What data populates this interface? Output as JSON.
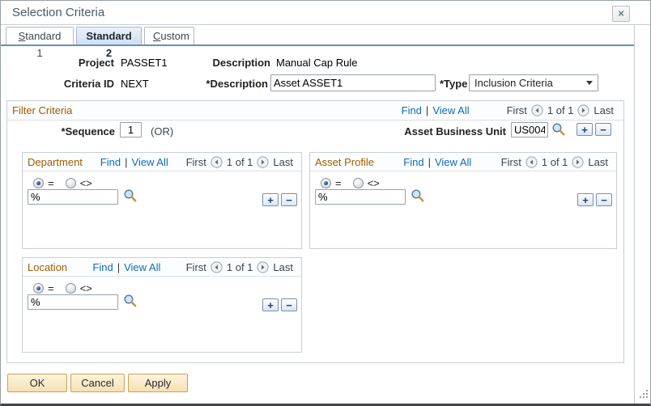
{
  "window": {
    "title": "Selection Criteria"
  },
  "icons": {
    "close": "×",
    "plus": "+",
    "minus": "−"
  },
  "tabs": [
    {
      "label": "Standard 1"
    },
    {
      "label": "Standard 2"
    },
    {
      "label": "Custom"
    }
  ],
  "fields": {
    "project_label": "Project",
    "project_value": "PASSET1",
    "description_label": "Description",
    "description_value": "Manual Cap Rule",
    "criteria_id_label": "Criteria ID",
    "criteria_id_value": "NEXT",
    "description_edit_label": "*Description",
    "description_edit_value": "Asset ASSET1",
    "type_label": "*Type",
    "type_value": "Inclusion Criteria"
  },
  "nav": {
    "find": "Find",
    "divider": "|",
    "view_all": "View All",
    "first": "First",
    "page": "1 of 1",
    "last": "Last"
  },
  "filter": {
    "title": "Filter Criteria",
    "sequence_label": "*Sequence",
    "sequence_value": "1",
    "or_label": "(OR)",
    "asset_business_unit_label": "Asset Business Unit",
    "asset_business_unit_value": "US004"
  },
  "groups": [
    {
      "title": "Department",
      "eq": "=",
      "ne": "<>",
      "value": "%"
    },
    {
      "title": "Asset Profile",
      "eq": "=",
      "ne": "<>",
      "value": "%"
    },
    {
      "title": "Location",
      "eq": "=",
      "ne": "<>",
      "value": "%"
    }
  ],
  "footer": {
    "ok": "OK",
    "cancel": "Cancel",
    "apply": "Apply"
  },
  "colors": {
    "group_title": "#9e5c00",
    "link": "#0d6cb5",
    "tab_line": "#6590bb",
    "button_border": "#d0a055"
  }
}
